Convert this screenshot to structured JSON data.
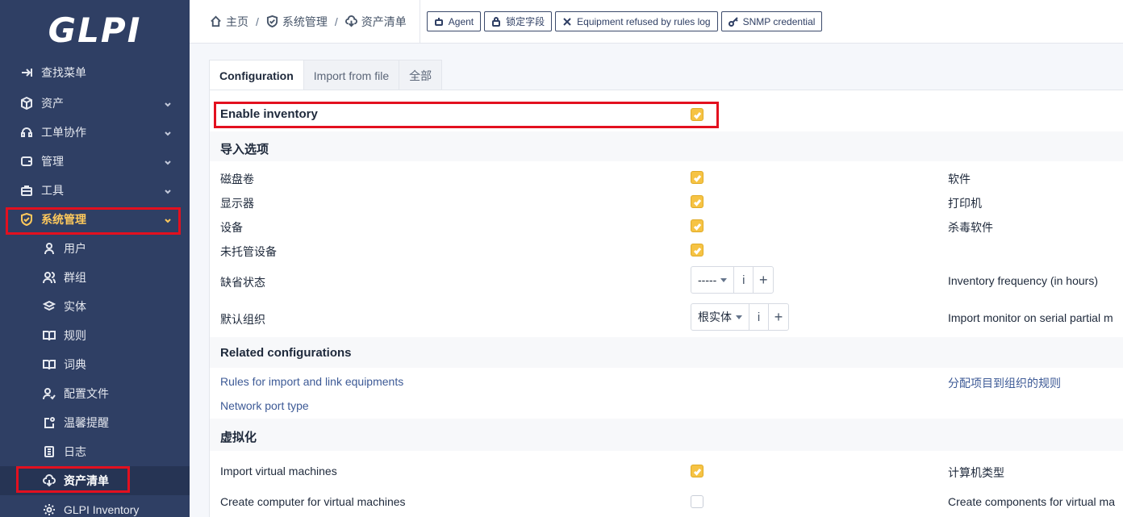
{
  "logo": "GLPI",
  "sidebar": {
    "items": [
      {
        "label": "查找菜单",
        "icon": "arrow-right-icon"
      },
      {
        "label": "资产",
        "icon": "box-icon"
      },
      {
        "label": "工单协作",
        "icon": "headset-icon"
      },
      {
        "label": "管理",
        "icon": "wallet-icon"
      },
      {
        "label": "工具",
        "icon": "briefcase-icon"
      },
      {
        "label": "系统管理",
        "icon": "shield-icon"
      }
    ],
    "sub_items": [
      {
        "label": "用户",
        "icon": "user-icon"
      },
      {
        "label": "群组",
        "icon": "users-icon"
      },
      {
        "label": "实体",
        "icon": "layers-icon"
      },
      {
        "label": "规则",
        "icon": "book-icon"
      },
      {
        "label": "词典",
        "icon": "book-icon"
      },
      {
        "label": "配置文件",
        "icon": "user-check-icon"
      },
      {
        "label": "温馨提醒",
        "icon": "note-icon"
      },
      {
        "label": "日志",
        "icon": "log-icon"
      },
      {
        "label": "资产清单",
        "icon": "cloud-download-icon"
      },
      {
        "label": "GLPI Inventory",
        "icon": "gear-icon"
      }
    ]
  },
  "breadcrumb": {
    "home": "主页",
    "admin": "系统管理",
    "inventory": "资产清单"
  },
  "top_buttons": {
    "agent": "Agent",
    "locked": "锁定字段",
    "refused": "Equipment refused by rules log",
    "snmp": "SNMP credential"
  },
  "tabs": {
    "configuration": "Configuration",
    "import": "Import from file",
    "all": "全部"
  },
  "form": {
    "enable_inventory": "Enable inventory",
    "import_options": "导入选项",
    "volumes": "磁盘卷",
    "monitors": "显示器",
    "peripherals": "设备",
    "unmanaged": "未托管设备",
    "default_status": "缺省状态",
    "default_status_value": "-----",
    "default_entity": "默认组织",
    "default_entity_value": "根实体",
    "software": "软件",
    "printers": "打印机",
    "antivirus": "杀毒软件",
    "inventory_frequency": "Inventory frequency (in hours)",
    "import_monitor_serial": "Import monitor on serial partial m",
    "related_configs": "Related configurations",
    "rules_import": "Rules for import and link equipments",
    "assign_rules": "分配项目到组织的规则",
    "network_port_type": "Network port type",
    "virtualization": "虚拟化",
    "import_vms": "Import virtual machines",
    "computer_type": "计算机类型",
    "create_computer_vms": "Create computer for virtual machines",
    "create_components_vms": "Create components for virtual ma",
    "info_glyph": "i",
    "add_glyph": "+"
  }
}
